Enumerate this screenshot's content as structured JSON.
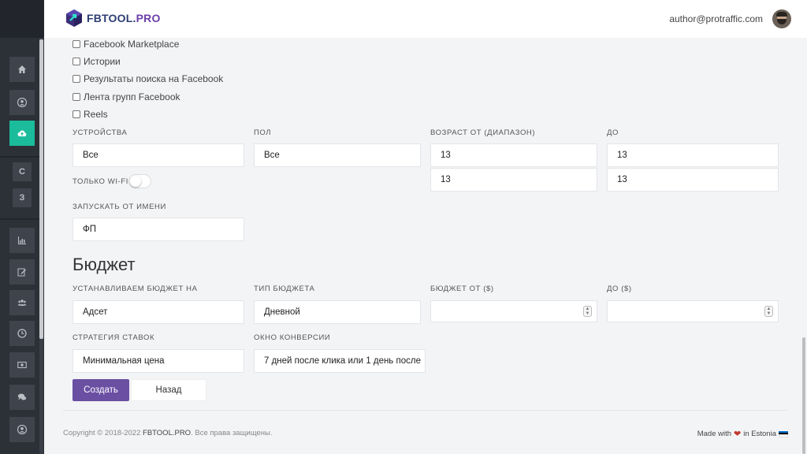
{
  "header": {
    "brand_main": "FBTOOL.",
    "brand_accent": "PRO",
    "user_email": "author@protraffic.com"
  },
  "sidebar": {
    "items": [
      {
        "icon": "home-icon"
      },
      {
        "icon": "user-circle-icon"
      },
      {
        "icon": "cloud-upload-icon",
        "active": true
      },
      {
        "label": "C"
      },
      {
        "label": "З"
      },
      {
        "icon": "bar-chart-icon"
      },
      {
        "icon": "edit-icon"
      },
      {
        "icon": "users-icon"
      },
      {
        "icon": "clock-icon"
      },
      {
        "icon": "money-icon"
      },
      {
        "icon": "comments-icon"
      },
      {
        "icon": "user-icon"
      }
    ]
  },
  "placements": [
    {
      "label": "Facebook Marketplace",
      "checked": false
    },
    {
      "label": "Истории",
      "checked": false
    },
    {
      "label": "Результаты поиска на Facebook",
      "checked": false
    },
    {
      "label": "Лента групп Facebook",
      "checked": false
    },
    {
      "label": "Reels",
      "checked": false
    }
  ],
  "targeting": {
    "devices_label": "УСТРОЙСТВА",
    "devices_value": "Все",
    "gender_label": "ПОЛ",
    "gender_value": "Все",
    "age_from_label": "ВОЗРАСТ ОТ (ДИАПАЗОН)",
    "age_from_1": "13",
    "age_from_2": "13",
    "age_to_label": "ДО",
    "age_to_1": "13",
    "age_to_2": "13",
    "wifi_label": "ТОЛЬКО WI-FI",
    "wifi_on": false,
    "run_as_label": "ЗАПУСКАТЬ ОТ ИМЕНИ",
    "run_as_value": "ФП"
  },
  "budget": {
    "title": "Бюджет",
    "level_label": "УСТАНАВЛИВАЕМ БЮДЖЕТ НА",
    "level_value": "Адсет",
    "type_label": "ТИП БЮДЖЕТА",
    "type_value": "Дневной",
    "from_label": "БЮДЖЕТ ОТ ($)",
    "from_value": "",
    "to_label": "ДО ($)",
    "to_value": "",
    "strategy_label": "СТРАТЕГИЯ СТАВОК",
    "strategy_value": "Минимальная цена",
    "window_label": "ОКНО КОНВЕРСИИ",
    "window_value": "7 дней после клика или 1 день после"
  },
  "actions": {
    "create_label": "Создать",
    "back_label": "Назад"
  },
  "footer": {
    "copyright_prefix": "Copyright © 2018-2022 ",
    "copyright_brand": "FBTOOL.PRO",
    "copyright_suffix": ". Все права защищены.",
    "made_with": "Made with",
    "in_estonia": "in Estonia"
  },
  "colors": {
    "sidebar_bg": "#2c3037",
    "sidebar_active": "#1abc9c",
    "primary_button": "#6a4fa3",
    "brand_dark": "#2d3e73",
    "brand_accent": "#6b3fa8"
  }
}
